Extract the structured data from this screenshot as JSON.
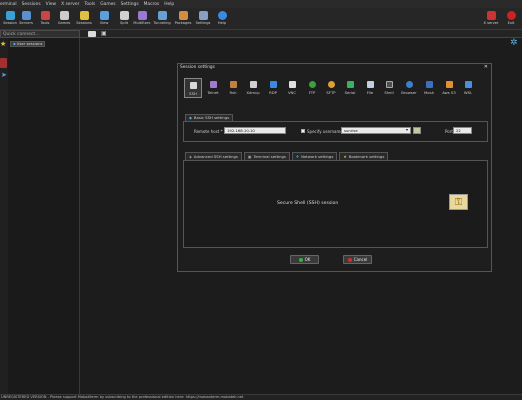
{
  "menu": [
    "erminal",
    "Sessions",
    "View",
    "X server",
    "Tools",
    "Games",
    "Settings",
    "Macros",
    "Help"
  ],
  "toolbar": {
    "left": [
      {
        "label": "Session",
        "color": "#3aa0d8"
      },
      {
        "label": "Servers",
        "color": "#5a8fd0"
      },
      {
        "label": "Tools",
        "color": "#cc4444"
      },
      {
        "label": "Games",
        "color": "#cccccc"
      },
      {
        "label": "Sessions",
        "color": "#e0c040"
      },
      {
        "label": "View",
        "color": "#5aa0e0"
      },
      {
        "label": "Split",
        "color": "#d0d0d0"
      },
      {
        "label": "MultiExec",
        "color": "#9a7ad0"
      },
      {
        "label": "Tunneling",
        "color": "#6aa0d0"
      },
      {
        "label": "Packages",
        "color": "#d09040"
      },
      {
        "label": "Settings",
        "color": "#8aa0c0"
      },
      {
        "label": "Help",
        "color": "#3a8ae0"
      }
    ],
    "right": [
      {
        "label": "X server",
        "color": "#cc3333"
      },
      {
        "label": "Exit",
        "color": "#cc2222"
      }
    ]
  },
  "quick_connect": {
    "placeholder": "Quick connect..."
  },
  "sessions_tree": {
    "item": "User sessions"
  },
  "dialog": {
    "title": "Session settings",
    "close": "✕",
    "protocols": [
      {
        "label": "SSH",
        "color": "#d8d8d8"
      },
      {
        "label": "Telnet",
        "color": "#a07ad0"
      },
      {
        "label": "Rsh",
        "color": "#c08040"
      },
      {
        "label": "Xdmcp",
        "color": "#d0d0d0"
      },
      {
        "label": "RDP",
        "color": "#3a8ae0"
      },
      {
        "label": "VNC",
        "color": "#e0e0e0"
      },
      {
        "label": "FTP",
        "color": "#3aa040"
      },
      {
        "label": "SFTP",
        "color": "#e0a030"
      },
      {
        "label": "Serial",
        "color": "#3ab060"
      },
      {
        "label": "File",
        "color": "#c0d0e0"
      },
      {
        "label": "Shell",
        "color": "#505050"
      },
      {
        "label": "Browser",
        "color": "#3a80d0"
      },
      {
        "label": "Mosh",
        "color": "#3a70c0"
      },
      {
        "label": "Aws S3",
        "color": "#e09030"
      },
      {
        "label": "WSL",
        "color": "#4a90e0"
      }
    ],
    "basic_tab": "Basic SSH settings",
    "remote_host_label": "Remote host *",
    "remote_host_value": "192.168.10.10",
    "specify_username_label": "Specify username",
    "username_value": "sunrise",
    "port_label": "Port",
    "port_value": "22",
    "subtabs": [
      "Advanced SSH settings",
      "Terminal settings",
      "Network settings",
      "Bookmark settings"
    ],
    "panel_text": "Secure Shell (SSH) session",
    "ok": "OK",
    "cancel": "Cancel"
  },
  "status_bar": "UNREGISTERED VERSION  -  Please support MobaXterm by subscribing to the professional edition here:  https://mobaxterm.mobatek.net"
}
